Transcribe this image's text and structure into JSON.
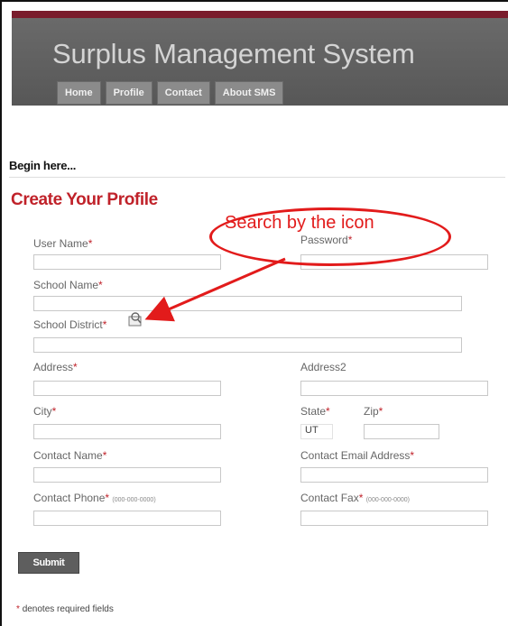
{
  "header": {
    "title": "Surplus Management System",
    "nav": [
      "Home",
      "Profile",
      "Contact",
      "About SMS"
    ]
  },
  "intro": "Begin here...",
  "form": {
    "title": "Create Your Profile",
    "labels": {
      "user_name": "User Name",
      "password": "Password",
      "school_name": "School Name",
      "school_district": "School District",
      "address": "Address",
      "address2": "Address2",
      "city": "City",
      "state": "State",
      "zip": "Zip",
      "contact_name": "Contact Name",
      "contact_email": "Contact Email Address",
      "contact_phone": "Contact Phone",
      "contact_fax": "Contact Fax"
    },
    "required_mark": "*",
    "phone_format": "(000-000-0000)",
    "values": {
      "state": "UT"
    },
    "submit_label": "Submit",
    "required_note": "denotes required fields"
  },
  "annotation": {
    "callout": "Search by the icon",
    "color": "#e21b1b"
  },
  "icons": {
    "lookup": "search-lookup-icon"
  }
}
